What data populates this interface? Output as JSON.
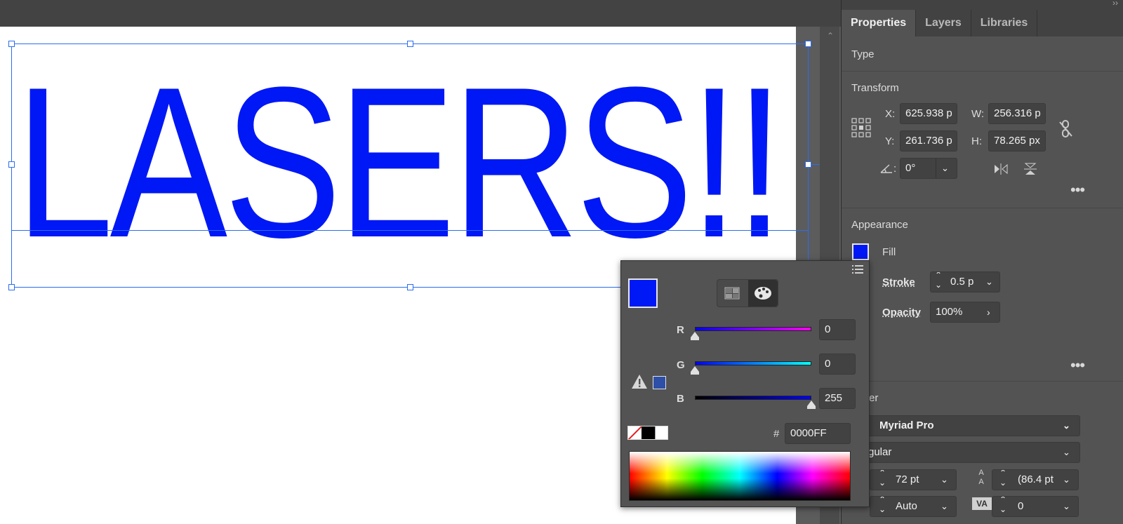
{
  "canvas": {
    "text": "LASERS!!",
    "text_color": "#0018F5"
  },
  "panel": {
    "tabs": [
      "Properties",
      "Layers",
      "Libraries"
    ],
    "type_section": "Type",
    "transform": {
      "title": "Transform",
      "x_label": "X:",
      "x_value": "625.938 p",
      "y_label": "Y:",
      "y_value": "261.736 p",
      "w_label": "W:",
      "w_value": "256.316 p",
      "h_label": "H:",
      "h_value": "78.265 px",
      "angle_label": ":",
      "angle_value": "0°"
    },
    "appearance": {
      "title": "Appearance",
      "fill_label": "Fill",
      "fill_color": "#0018F5",
      "stroke_label": "Stroke",
      "stroke_value": "0.5 p",
      "opacity_label": "Opacity",
      "opacity_value": "100%"
    },
    "character": {
      "title": "racter",
      "font_family": "Myriad Pro",
      "font_style": "gular",
      "font_size": "72 pt",
      "leading": "(86.4 pt",
      "kerning": "Auto",
      "tracking": "0"
    }
  },
  "color_popup": {
    "swatch_color": "#0018F5",
    "r_label": "R",
    "r_value": "0",
    "g_label": "G",
    "g_value": "0",
    "b_label": "B",
    "b_value": "255",
    "hash_label": "#",
    "hex_value": "0000FF",
    "gamut_swatch_color": "#2E4FA8"
  }
}
